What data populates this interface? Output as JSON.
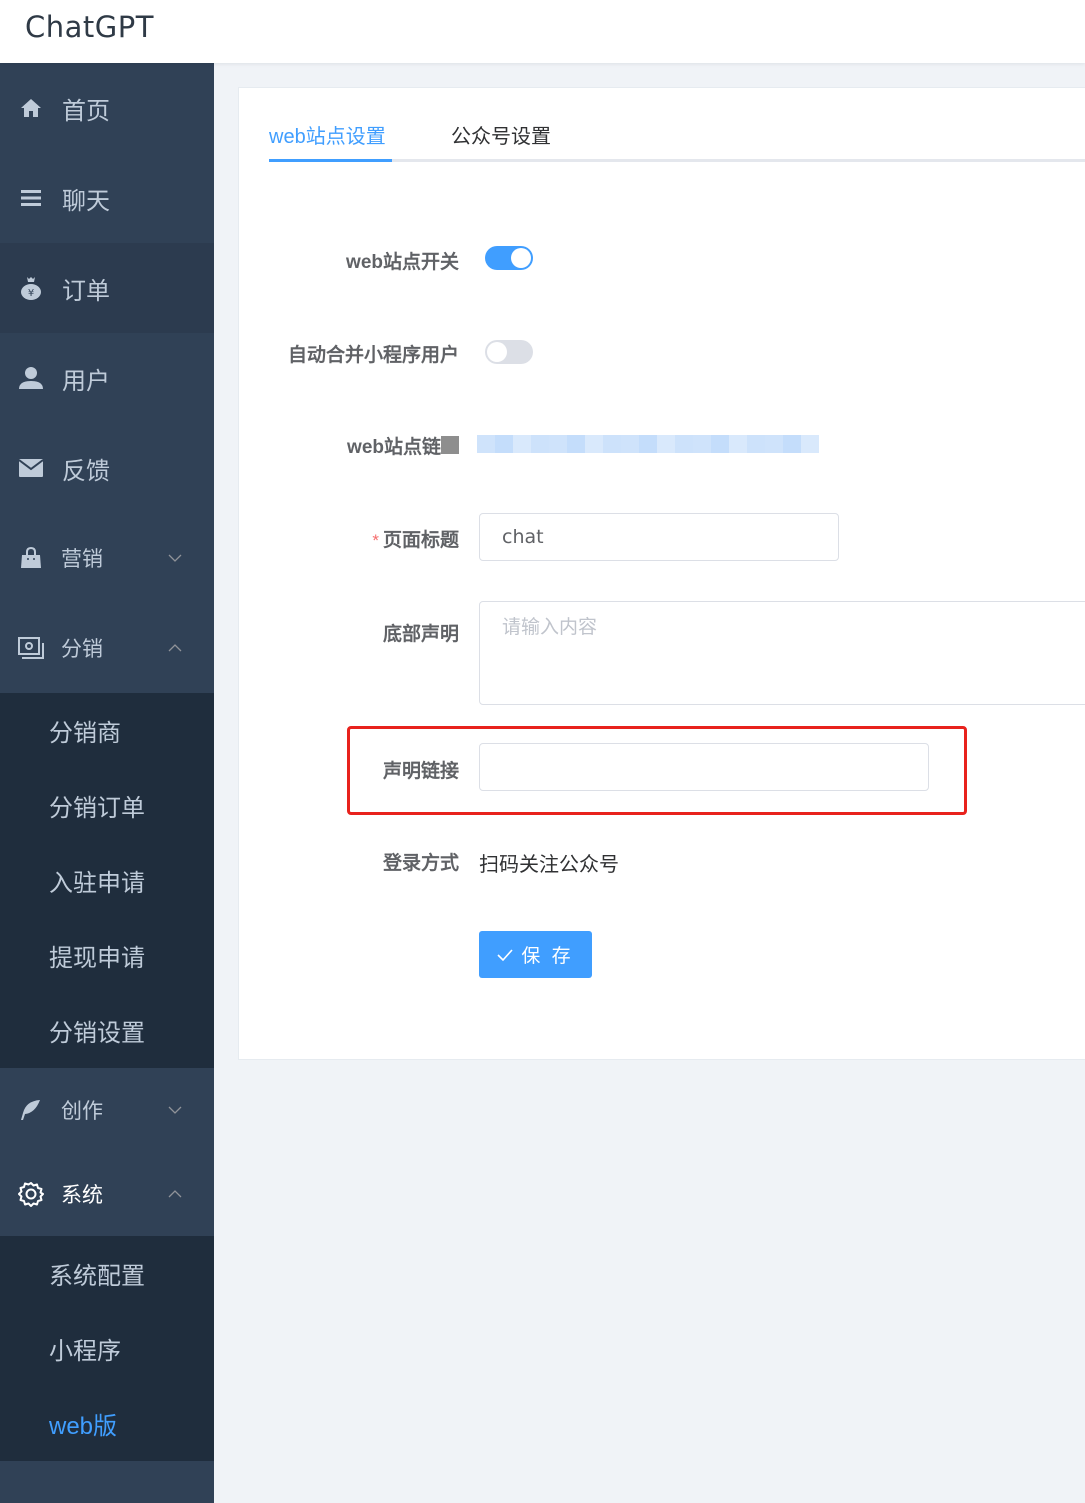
{
  "app": {
    "title": "ChatGPT"
  },
  "sidebar": {
    "items": [
      {
        "label": "首页",
        "icon": "home-icon"
      },
      {
        "label": "聊天",
        "icon": "list-icon"
      },
      {
        "label": "订单",
        "icon": "money-bag-icon",
        "state": "hover"
      },
      {
        "label": "用户",
        "icon": "user-icon"
      },
      {
        "label": "反馈",
        "icon": "mail-icon"
      }
    ],
    "groups": [
      {
        "label": "营销",
        "icon": "shopping-bag-icon",
        "expanded": false,
        "children": []
      },
      {
        "label": "分销",
        "icon": "photo-stack-icon",
        "expanded": true,
        "children": [
          "分销商",
          "分销订单",
          "入驻申请",
          "提现申请",
          "分销设置"
        ]
      },
      {
        "label": "创作",
        "icon": "feather-icon",
        "expanded": false,
        "children": []
      },
      {
        "label": "系统",
        "icon": "gear-icon",
        "expanded": true,
        "children": [
          "系统配置",
          "小程序",
          "web版"
        ],
        "active_child": "web版"
      }
    ]
  },
  "tabs": [
    {
      "label": "web站点设置",
      "active": true
    },
    {
      "label": "公众号设置",
      "active": false
    }
  ],
  "form": {
    "site_switch": {
      "label": "web站点开关",
      "value": true
    },
    "merge_users": {
      "label": "自动合并小程序用户",
      "value": false
    },
    "site_link": {
      "label": "web站点链",
      "value_redacted": true
    },
    "page_title": {
      "label": "页面标题",
      "required": true,
      "value": "chat"
    },
    "footer_statement": {
      "label": "底部声明",
      "value": "",
      "placeholder": "请输入内容"
    },
    "statement_link": {
      "label": "声明链接",
      "value": "",
      "highlighted": true
    },
    "login_method": {
      "label": "登录方式",
      "value": "扫码关注公众号"
    },
    "save_label": "保 存"
  },
  "colors": {
    "accent": "#409eff",
    "sidebar_bg": "#304156",
    "submenu_bg": "#1f2d3d",
    "highlight_box": "#e8221d"
  }
}
